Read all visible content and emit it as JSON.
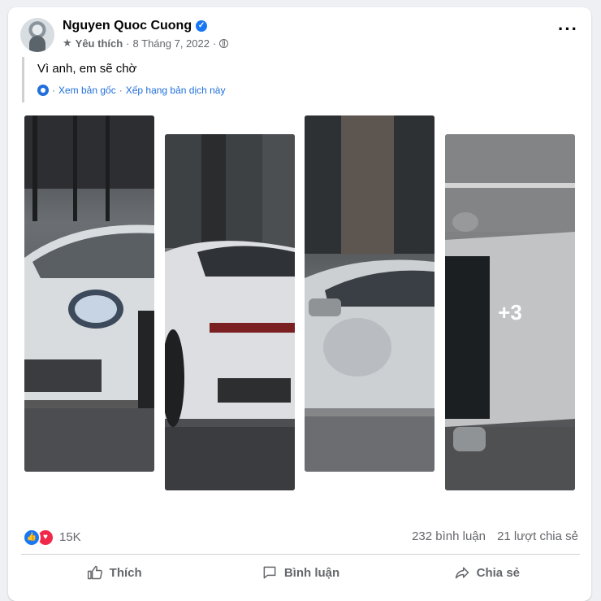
{
  "post": {
    "author": "Nguyen Quoc Cuong",
    "favorite_label": "Yêu thích",
    "date": "8 Tháng 7, 2022",
    "separator": "·",
    "text": "Vì anh, em sẽ chờ",
    "see_original": "Xem bản gốc",
    "rate_translation": "Xếp hạng bản dịch này",
    "more_photos_count": "+3"
  },
  "stats": {
    "reactions": "15K",
    "comments": "232 bình luận",
    "shares": "21 lượt chia sẻ"
  },
  "actions": {
    "like": "Thích",
    "comment": "Bình luận",
    "share": "Chia sẻ"
  },
  "colors": {
    "accent": "#1877f2",
    "love": "#f0284a",
    "secondary_text": "#65676b",
    "link": "#216fdb"
  },
  "icons": {
    "verified": "verified-badge-icon",
    "favorite": "star-icon",
    "privacy": "globe-icon",
    "translate": "gear-icon",
    "more": "more-options-icon",
    "like_reaction": "like-reaction-icon",
    "love_reaction": "love-reaction-icon",
    "like_action": "thumbs-up-icon",
    "comment_action": "comment-icon",
    "share_action": "share-icon"
  }
}
